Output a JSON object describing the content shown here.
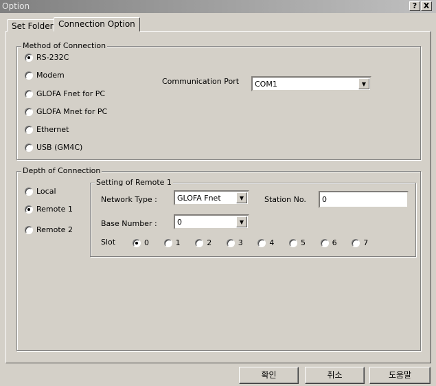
{
  "window": {
    "title": "Option",
    "help": "?",
    "close": "X"
  },
  "tabs": [
    {
      "label": "Set Folder",
      "active": false
    },
    {
      "label": "Connection Option",
      "active": true
    }
  ],
  "method": {
    "title": "Method of Connection",
    "options": [
      "RS-232C",
      "Modem",
      "GLOFA Fnet for PC",
      "GLOFA Mnet for PC",
      "Ethernet",
      "USB (GM4C)"
    ],
    "selected": "RS-232C",
    "port_label": "Communication Port",
    "port_value": "COM1"
  },
  "depth": {
    "title": "Depth of Connection",
    "options": [
      "Local",
      "Remote 1",
      "Remote 2"
    ],
    "selected": "Remote 1",
    "remote": {
      "title": "Setting of Remote 1",
      "network_label": "Network Type :",
      "network_value": "GLOFA Fnet",
      "station_label": "Station No.",
      "station_value": "0",
      "base_label": "Base Number :",
      "base_value": "0",
      "slot_label": "Slot",
      "slots": [
        "0",
        "1",
        "2",
        "3",
        "4",
        "5",
        "6",
        "7"
      ],
      "slot_selected": "0"
    }
  },
  "buttons": {
    "ok": "확인",
    "cancel": "취소",
    "help": "도움말"
  }
}
